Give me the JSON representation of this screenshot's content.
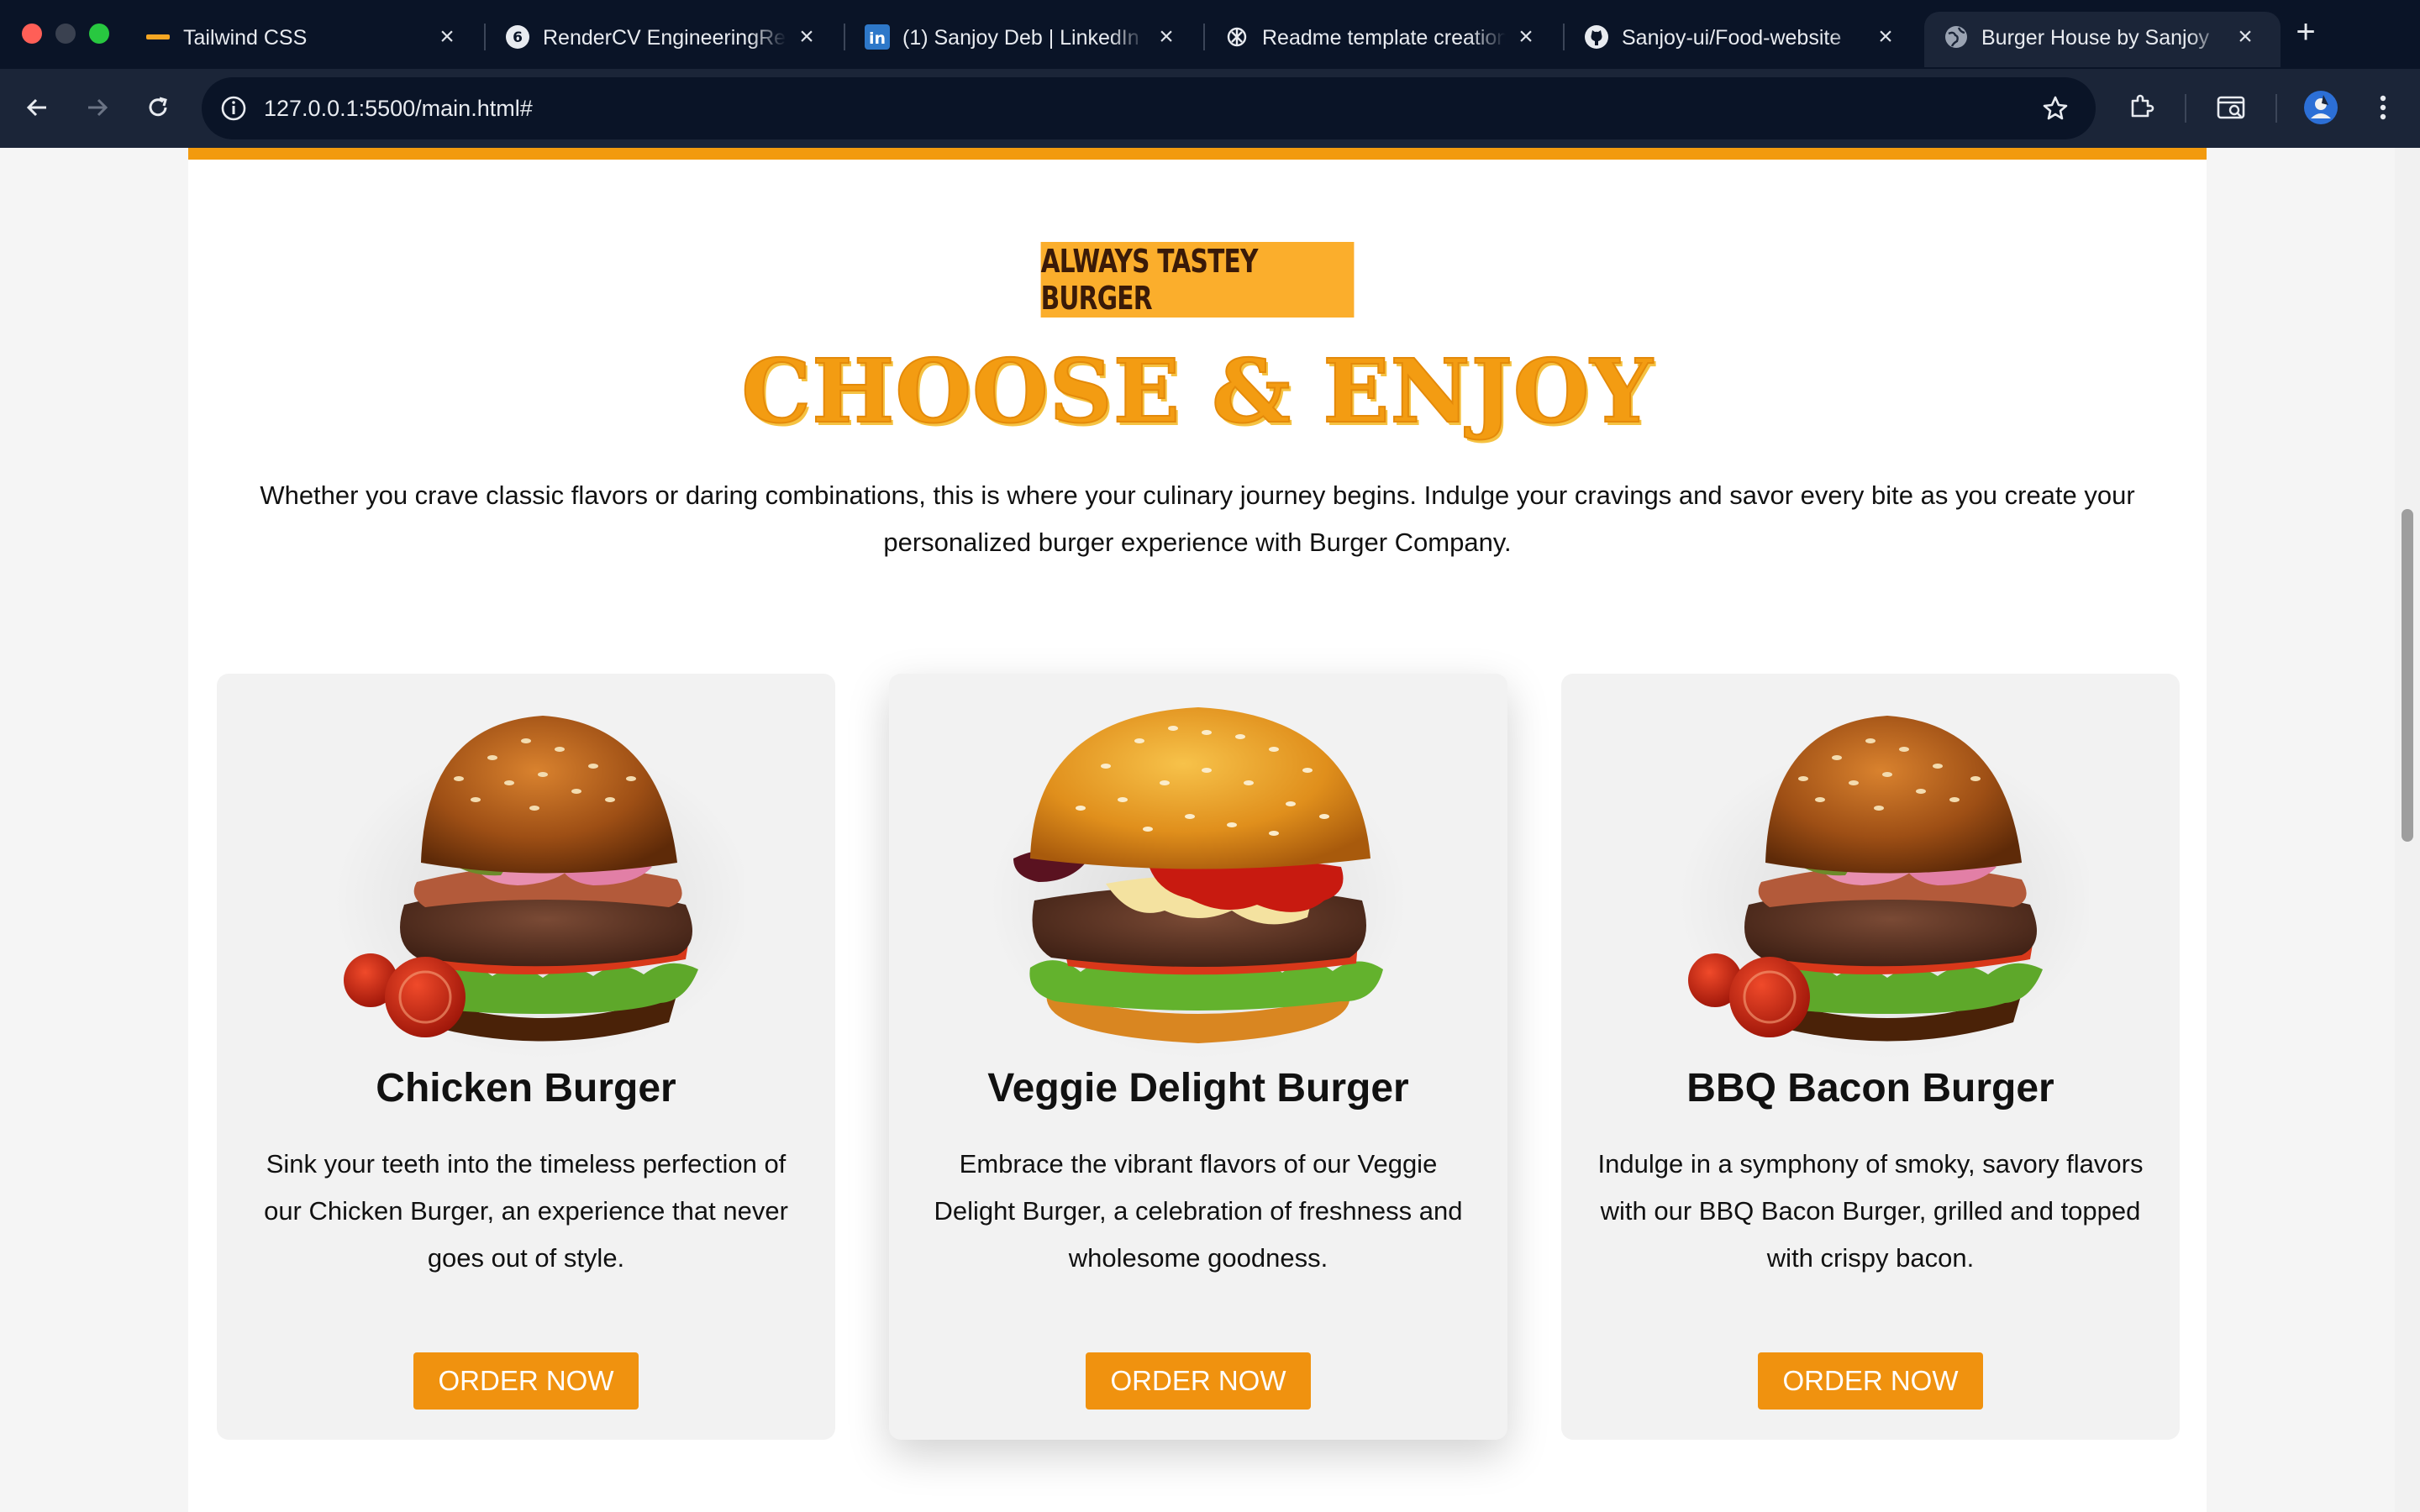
{
  "browser": {
    "tabs": [
      {
        "title": "Tailwind CSS",
        "favicon": "course-icon"
      },
      {
        "title": "RenderCV EngineeringResume",
        "favicon": "rendercv-icon"
      },
      {
        "title": "(1) Sanjoy Deb | LinkedIn",
        "favicon": "linkedin-icon"
      },
      {
        "title": "Readme template creation",
        "favicon": "chatgpt-icon"
      },
      {
        "title": "Sanjoy-ui/Food-website",
        "favicon": "github-icon"
      },
      {
        "title": "Burger House by Sanjoy",
        "favicon": "globe-icon",
        "active": true
      }
    ],
    "url": "127.0.0.1:5500/main.html#"
  },
  "section": {
    "badge": "ALWAYS TASTEY BURGER",
    "heading": "CHOOSE & ENJOY",
    "intro": "Whether you crave classic flavors or daring combinations, this is where your culinary journey begins. Indulge your cravings and savor every bite as you create your personalized burger experience with Burger Company."
  },
  "cards": [
    {
      "name": "Chicken Burger",
      "description": "Sink your teeth into the timeless perfection of our Chicken Burger, an experience that never goes out of style.",
      "button": "ORDER NOW"
    },
    {
      "name": "Veggie Delight Burger",
      "description": "Embrace the vibrant flavors of our Veggie Delight Burger, a celebration of freshness and wholesome goodness.",
      "button": "ORDER NOW"
    },
    {
      "name": "BBQ Bacon Burger",
      "description": "Indulge in a symphony of smoky, savory flavors with our BBQ Bacon Burger, grilled and topped with crispy bacon.",
      "button": "ORDER NOW"
    }
  ],
  "colors": {
    "accent": "#f29a0e",
    "badge": "#fbae2c",
    "chrome": "#0a1427"
  }
}
